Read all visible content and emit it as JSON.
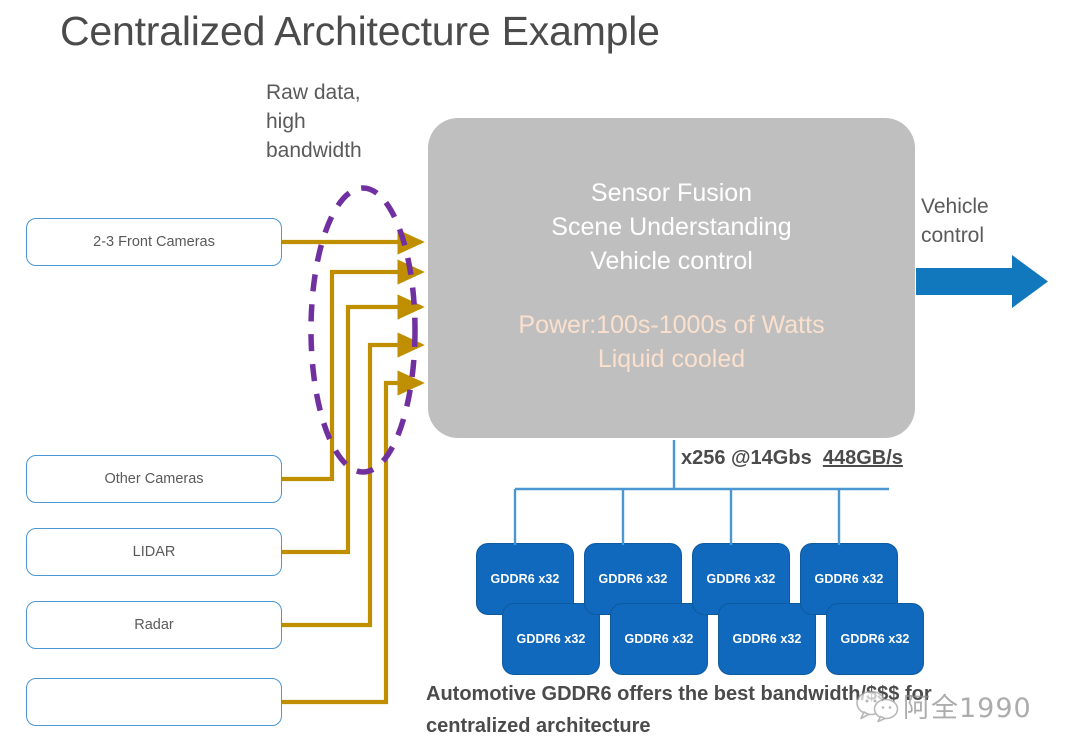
{
  "page": {
    "title": "Centralized Architecture Example",
    "title_color": "#4b4b4b",
    "background": "#ffffff"
  },
  "annotations": {
    "raw_data_label": "Raw data, high bandwidth",
    "raw_data_lines": [
      "Raw data,",
      "high",
      "bandwidth"
    ],
    "vehicle_control_label": "Vehicle control",
    "vehicle_control_lines": [
      "Vehicle",
      "control"
    ],
    "ellipse_color": "#7030a0",
    "ellipse_style": "dashed"
  },
  "sensors": {
    "box_border_color": "#4a97d2",
    "wire_color": "#bf8f00",
    "items": [
      {
        "label": "2-3 Front Cameras",
        "name": "front-cameras"
      },
      {
        "label": "Other Cameras",
        "name": "other-cameras"
      },
      {
        "label": "LIDAR",
        "name": "lidar"
      },
      {
        "label": "Radar",
        "name": "radar"
      },
      {
        "label": "",
        "name": "unlabeled-sensor"
      }
    ]
  },
  "central": {
    "fill_color": "#bfbfbf",
    "primary_lines": [
      "Sensor Fusion",
      "Scene Understanding",
      "Vehicle control"
    ],
    "secondary_lines": [
      "Power:100s-1000s of Watts",
      "Liquid cooled"
    ],
    "primary_color": "#ffffff",
    "secondary_color": "#fbe0ce"
  },
  "output": {
    "arrow_color": "#1278be"
  },
  "memory": {
    "bandwidth_prefix": "x256 @14Gbs",
    "bandwidth_value": "448GB/s",
    "block_color": "#1069bd",
    "connector_color": "#4a97d2",
    "stacks": [
      {
        "back_label": "GDDR6 x32",
        "front_label": "GDDR6 x32"
      },
      {
        "back_label": "GDDR6 x32",
        "front_label": "GDDR6 x32"
      },
      {
        "back_label": "GDDR6 x32",
        "front_label": "GDDR6 x32"
      },
      {
        "back_label": "GDDR6 x32",
        "front_label": "GDDR6 x32"
      }
    ]
  },
  "footer": {
    "statement": "Automotive GDDR6 offers the best bandwidth/$$$ for centralized architecture",
    "statement_lines": [
      "Automotive GDDR6 offers the best bandwidth/$$$ for",
      "centralized architecture"
    ]
  },
  "watermark": {
    "text": "阿全1990",
    "icon": "wechat-bubbles-icon"
  }
}
